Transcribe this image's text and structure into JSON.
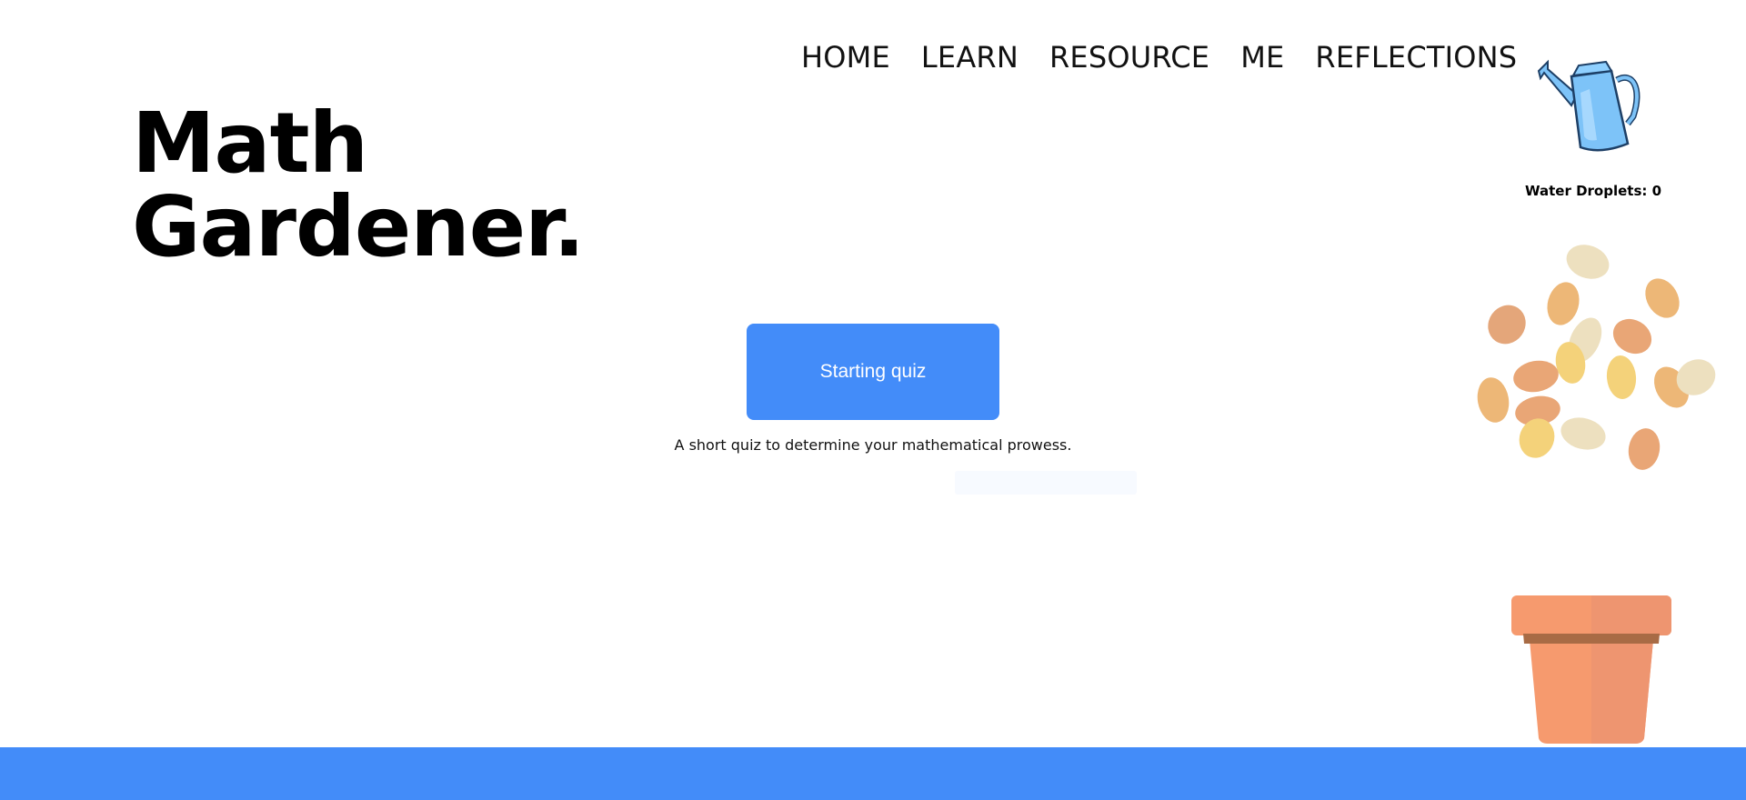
{
  "nav": [
    "HOME",
    "LEARN",
    "RESOURCE",
    "ME",
    "REFLECTIONS"
  ],
  "title": {
    "line1": "Math",
    "line2": "Gardener."
  },
  "droplets": {
    "label": "Water Droplets: 0"
  },
  "quiz": {
    "button_label": "Starting quiz",
    "description": "A short quiz to determine your mathematical prowess."
  },
  "colors": {
    "primary": "#438cf9",
    "pot": "#f69a6e",
    "can": "#7dc3f8",
    "seed_orange": "#e9a676",
    "seed_yellow": "#f4d27a",
    "seed_cream": "#ede0bf"
  },
  "icons": [
    "watering-can-icon",
    "seeds-illustration",
    "flower-pot-illustration"
  ]
}
